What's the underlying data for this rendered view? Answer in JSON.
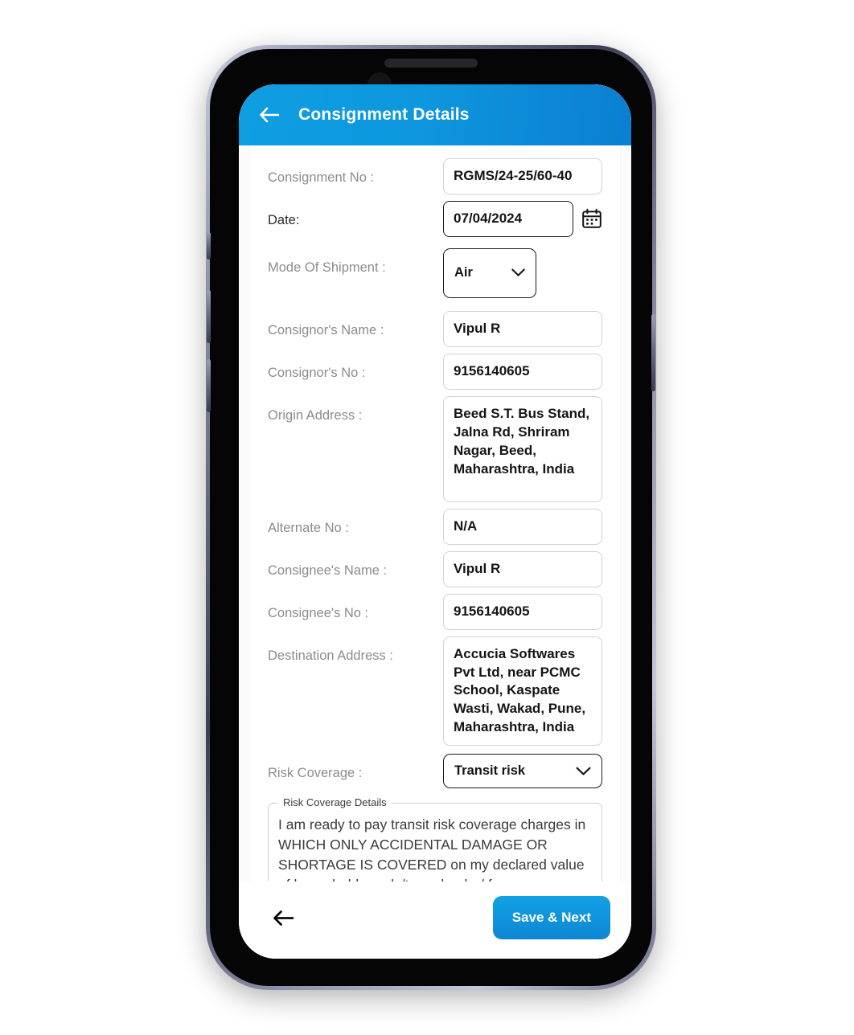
{
  "app": {
    "title": "Consignment Details",
    "back_icon": "arrow-left-icon",
    "accent_color": "#0e97de",
    "header_gradient_from": "#0f9ee2",
    "header_gradient_to": "#0b7fd1"
  },
  "form": {
    "fields": [
      {
        "label": "Consignment No :",
        "value": "RGMS/24-25/60-40",
        "type": "text"
      },
      {
        "label": "Date:",
        "value": "07/04/2024",
        "type": "date",
        "icon": "calendar-icon"
      },
      {
        "label": "Mode Of Shipment :",
        "value": "Air",
        "type": "select"
      },
      {
        "label": "Consignor's Name :",
        "value": "Vipul R",
        "type": "text"
      },
      {
        "label": "Consignor's No :",
        "value": "9156140605",
        "type": "text"
      },
      {
        "label": "Origin Address :",
        "value": "Beed S.T. Bus Stand, Jalna Rd, Shriram Nagar, Beed, Maharashtra, India",
        "type": "textarea"
      },
      {
        "label": "Alternate No :",
        "value": "N/A",
        "type": "text"
      },
      {
        "label": "Consignee's Name :",
        "value": "Vipul R",
        "type": "text"
      },
      {
        "label": "Consignee's No :",
        "value": "9156140605",
        "type": "text"
      },
      {
        "label": "Destination Address :",
        "value": "Accucia Softwares Pvt Ltd, near PCMC School, Kaspate Wasti, Wakad, Pune, Maharashtra, India",
        "type": "textarea"
      },
      {
        "label": "Risk Coverage :",
        "value": "Transit risk",
        "type": "select"
      }
    ],
    "risk_details": {
      "legend": "Risk Coverage Details",
      "text": "I am ready to pay transit risk coverage charges in WHICH ONLY ACCIDENTAL DAMAGE OR SHORTAGE IS COVERED on my declared value of household goods/two wheeler/ four wheeler/others."
    }
  },
  "bottom_bar": {
    "back_icon": "arrow-left-icon",
    "save_label": "Save & Next"
  }
}
